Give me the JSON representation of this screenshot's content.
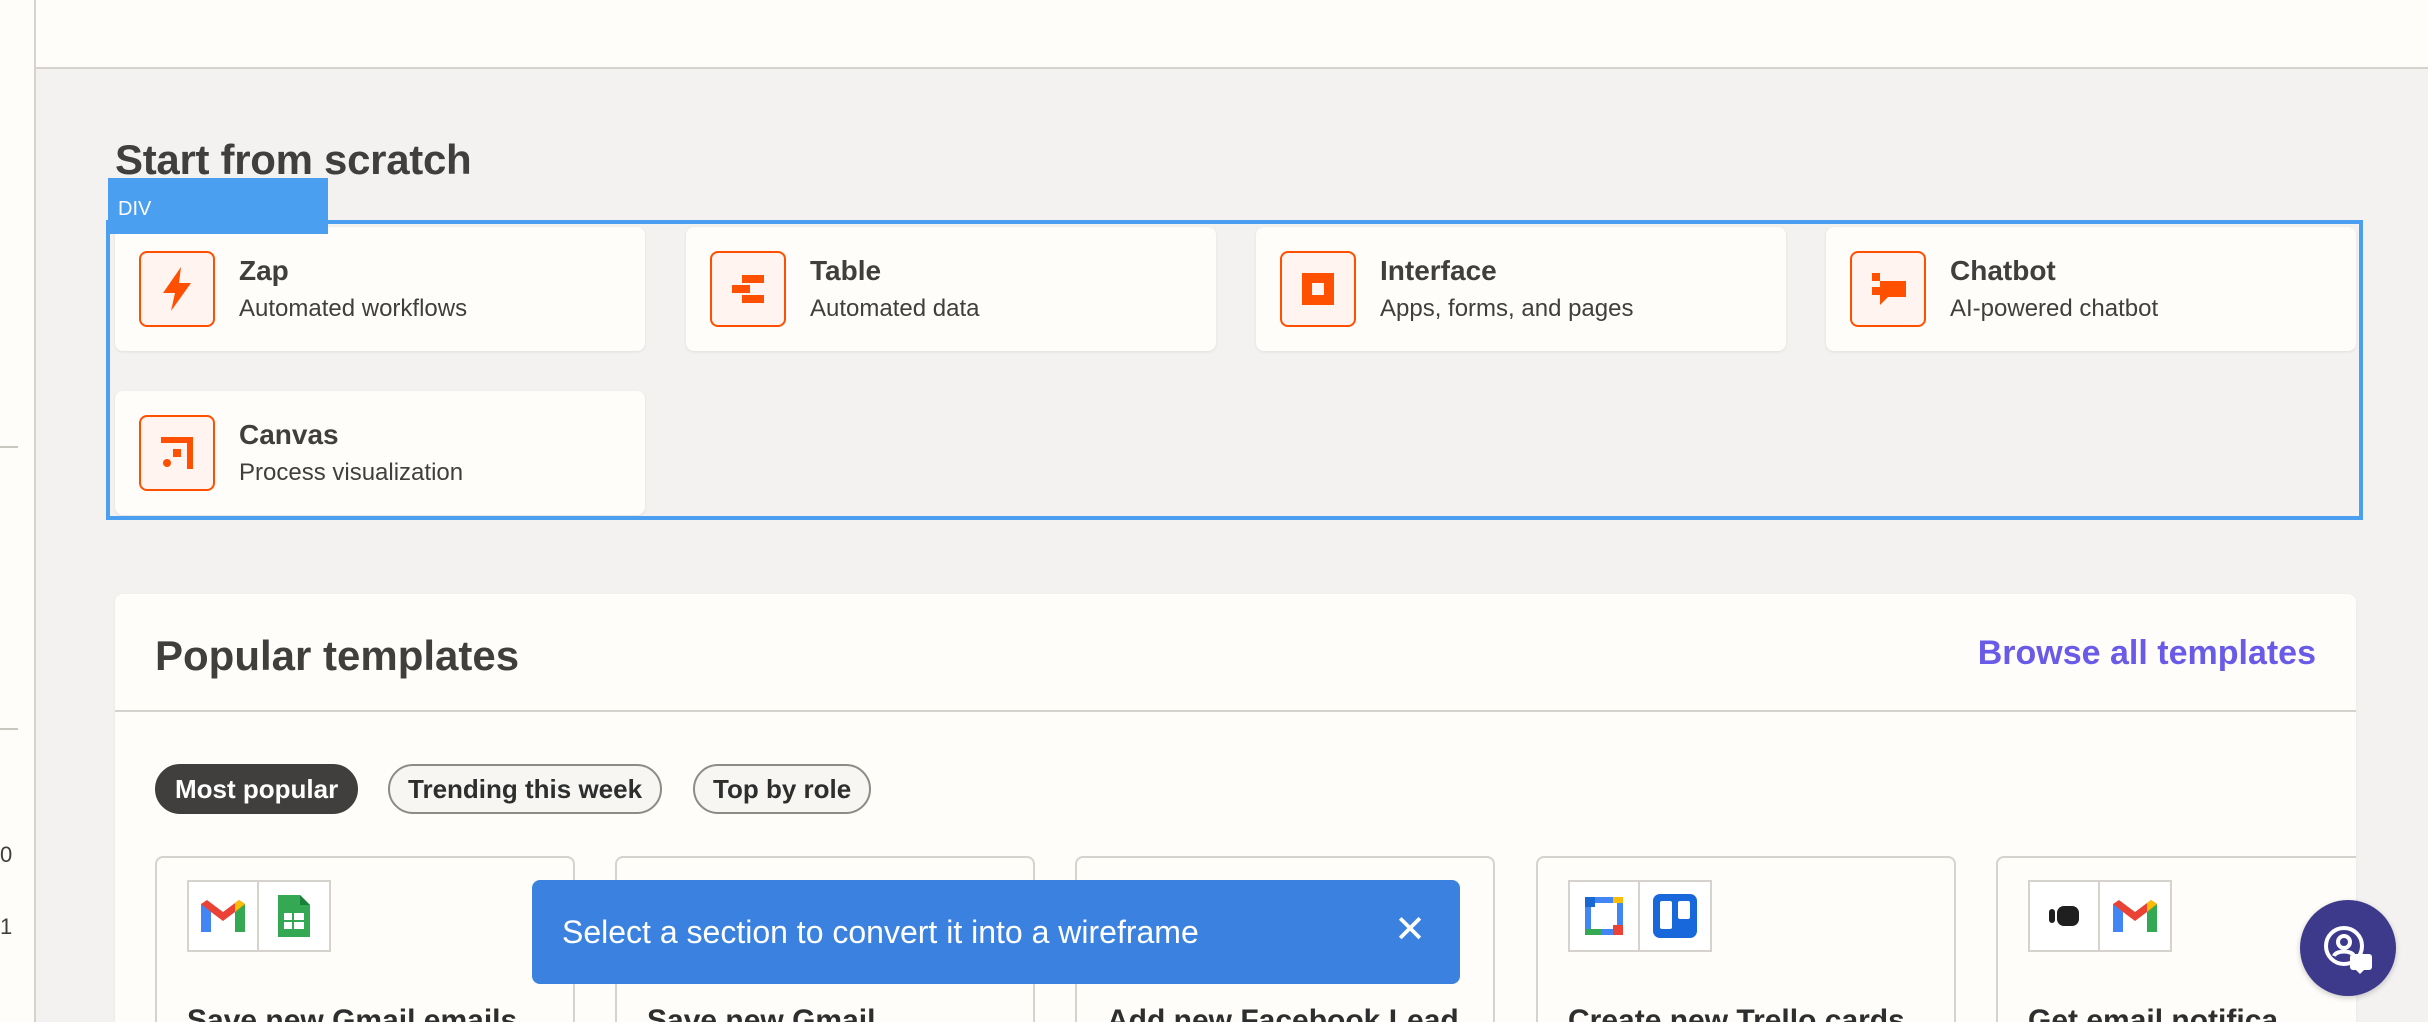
{
  "rail": {
    "glyph_a": "0",
    "glyph_b": "1"
  },
  "scratch": {
    "title": "Start from scratch",
    "selection_tag": "DIV",
    "cards": [
      {
        "title": "Zap",
        "subtitle": "Automated workflows",
        "icon": "lightning-bolt-icon"
      },
      {
        "title": "Table",
        "subtitle": "Automated data",
        "icon": "table-icon"
      },
      {
        "title": "Interface",
        "subtitle": "Apps, forms, and pages",
        "icon": "interface-icon"
      },
      {
        "title": "Chatbot",
        "subtitle": "AI-powered chatbot",
        "icon": "chatbot-icon"
      },
      {
        "title": "Canvas",
        "subtitle": "Process visualization",
        "icon": "canvas-icon"
      }
    ]
  },
  "templates": {
    "title": "Popular templates",
    "browse_label": "Browse all templates",
    "tabs": [
      {
        "label": "Most popular",
        "active": true
      },
      {
        "label": "Trending this week",
        "active": false
      },
      {
        "label": "Top by role",
        "active": false
      }
    ],
    "items": [
      {
        "title": "Save new Gmail emails",
        "apps": [
          "gmail-icon",
          "google-sheets-icon"
        ]
      },
      {
        "title": "Save new Gmail",
        "apps": []
      },
      {
        "title": "Add new Facebook Lead",
        "apps": []
      },
      {
        "title": "Create new Trello cards",
        "apps": [
          "google-calendar-icon",
          "trello-icon"
        ]
      },
      {
        "title": "Get email notifica",
        "apps": [
          "intercom-icon",
          "gmail-icon"
        ]
      }
    ]
  },
  "toast": {
    "message": "Select a section to convert it into a wireframe",
    "close_label": "✕"
  },
  "colors": {
    "accent": "#ff4f00",
    "link": "#695be8",
    "toast": "#3b82e0",
    "selection": "#4a9ff0",
    "fab": "#3d3a8c"
  }
}
